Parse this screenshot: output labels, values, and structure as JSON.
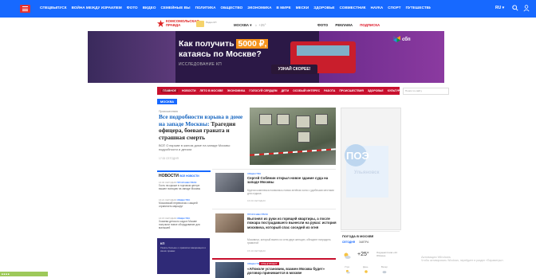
{
  "topnav": {
    "links": [
      "СПЕЦВЫПУСК",
      "ВОЙНА МЕЖДУ ИЗРАИЛЕМ",
      "ФОТО",
      "ВИДЕО",
      "СЕМЕЙНЫЕ ВЫ",
      "ПОЛИТИКА",
      "ОБЩЕСТВО",
      "ЭКОНОМИКА",
      "В МИРЕ",
      "МЕСКИ",
      "ЗДОРОВЬЕ",
      "СОВМЕСТНИК",
      "НАУКА",
      "СПОРТ",
      "ПУТЕШЕСТВИЯ",
      "ПРОИСШЕСТВИЯ"
    ],
    "lang": "RU ▾",
    "colors": {
      "bar": "#1769ff",
      "menu": "#e5312f"
    }
  },
  "logobar": {
    "logo_line1": "Комсомольская",
    "logo_line2": "правда",
    "partner_small": "Радио КП",
    "city": "МОСКВА ▾",
    "weather": "☼ +25°",
    "right_links": [
      "ФОТО",
      "РЕКЛАМА",
      "ПОДПИСКА"
    ],
    "special_link": "ПОДПИСКА"
  },
  "banner": {
    "title_before": "Как получить ",
    "title_highlight": "5000 ₽,",
    "title_line2": "катаясь по Москве?",
    "subtitle": "ИССЛЕДОВАНИЕ КП",
    "button": "УЗНАЙ СКОРЕЕ!",
    "brand": "сбп"
  },
  "secnav": {
    "items": [
      "ГЛАВНОЕ",
      "НОВОСТИ",
      "ЛЕТО В МОСКВЕ",
      "ЭКОНОМИКА",
      "ГОЛОСУЙ СЕРДЦЕМ",
      "ДЕТИ",
      "ОСОБЫЙ ИНТЕРЕС",
      "РАБОТА",
      "ПРОИСШЕСТВИЯ",
      "ЗДОРОВЬЕ",
      "КУЛЬТУРА"
    ],
    "active": "ГЛАВНОЕ",
    "search_placeholder": "Поиск по сайту"
  },
  "section_label": "МОСКВА",
  "main_article": {
    "small": "Происшествия",
    "title_blue": "Все подробности взрыва в доме на западе Москвы:",
    "title_dark": " Трагедия офицера, боевая граната и страшная смерть",
    "lead": "ВСЁ О взрыве в жилом доме на западе Москвы: подробности и детали",
    "time": "17:00 СЕГОДНЯ"
  },
  "news": {
    "title": "НОВОСТИ",
    "more": "ВСЕ НОВОСТИ",
    "items": [
      {
        "meta_time": "16:30 СЕГОДНЯ",
        "meta_tag": "ПРОИСШЕСТВИЯ",
        "text": "Гость на крыше в торговом центре вышел полицию на западе Москвы"
      },
      {
        "meta_time": "16:21 СЕГОДНЯ",
        "meta_tag": "ОБЩЕСТВО",
        "text": "Московский перевозчик с акцией ограничить маршрут"
      },
      {
        "meta_time": "16:15 СЕГОДНЯ",
        "meta_tag": "ОБЩЕСТВО",
        "text": "Хозяева детского сада в Москве получили новое оборудование для малышей"
      }
    ],
    "promo_title": "КП",
    "promo_text": "Узнать больше о правилах вакцинации и своих правах"
  },
  "feed": [
    {
      "tag": "ОБЩЕСТВО",
      "title": "Сергей Собянин открыл новое здание суда на западе Москвы",
      "lead": "Кругом комплекса появилась новая зелёная зона с удобными местами для отдыха",
      "time": "16:00 СЕГОДНЯ"
    },
    {
      "tag": "ПРОИСШЕСТВИЯ",
      "title": "Выгонял из руки из горящей квартиры, а после пожара пострадавшего вынесли на руках: история москвича, который спас соседей из огня",
      "lead": "Москвичи, который вынес из огня двух женщин, обещают наградить грамотой",
      "time": "15:40 СЕГОДНЯ"
    },
    {
      "tag": "ОБЩЕСТВО",
      "tag2": "СПЕЦПРОЕКТ",
      "title": "«АПоколе установим, взамен Москва будет» договор принимается в москве",
      "lead": "",
      "time": ""
    }
  ],
  "side_ad": {
    "logo": "ПОЭ",
    "city": "Ульяновск"
  },
  "weather_widget": {
    "title": "ПОГОДА В МОСКВЕ",
    "tabs": [
      "СЕГОДНЯ",
      "ЗАВТРА"
    ],
    "active_tab": "СЕГОДНЯ",
    "temp": "+25°",
    "extra": "Ощущается как +24 Облачно",
    "periods": [
      "Утро",
      "День",
      "Вечер"
    ]
  },
  "watermark": {
    "line1": "Активация Windows",
    "line2": "Чтобы активировать Windows, перейдите в раздел «Параметры»."
  },
  "bottom_strip": "■ ■ ■ ■"
}
